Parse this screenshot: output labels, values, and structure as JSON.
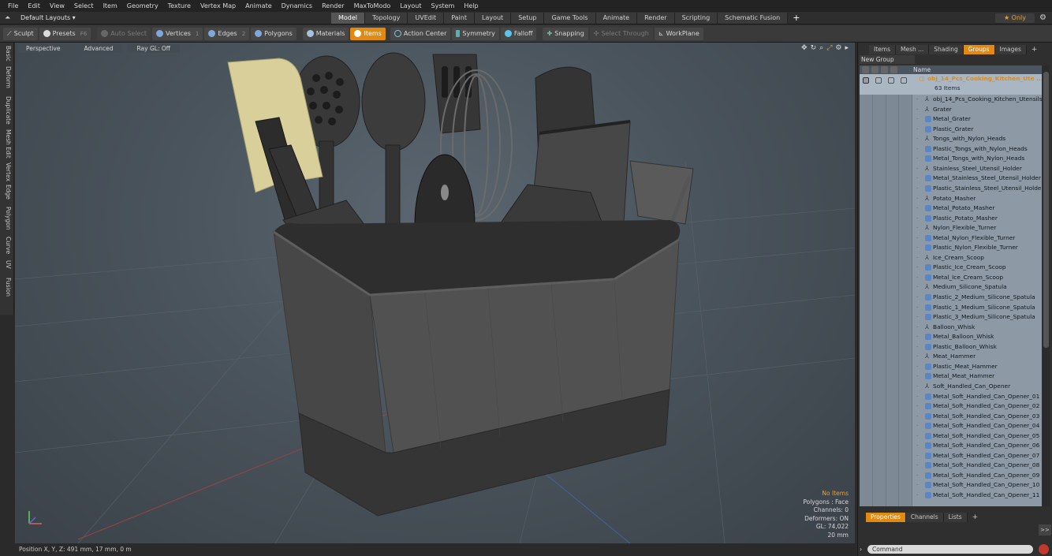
{
  "menu": [
    "File",
    "Edit",
    "View",
    "Select",
    "Item",
    "Geometry",
    "Texture",
    "Vertex Map",
    "Animate",
    "Dynamics",
    "Render",
    "MaxToModo",
    "Layout",
    "System",
    "Help"
  ],
  "layout": {
    "selector": "Default Layouts ▾",
    "tabs": [
      "Model",
      "Topology",
      "UVEdit",
      "Paint",
      "Layout",
      "Setup",
      "Game Tools",
      "Animate",
      "Render",
      "Scripting",
      "Schematic Fusion"
    ],
    "active_tab": "Model",
    "only_label": "★  Only"
  },
  "toolbar": {
    "sculpt": "Sculpt",
    "presets": "Presets",
    "presets_key": "F6",
    "auto_select": "Auto Select",
    "vertices": "Vertices",
    "vertices_num": "1",
    "edges": "Edges",
    "edges_num": "2",
    "polygons": "Polygons",
    "materials": "Materials",
    "items": "Items",
    "action_center": "Action Center",
    "symmetry": "Symmetry",
    "falloff": "Falloff",
    "snapping": "Snapping",
    "select_through": "Select Through",
    "workplane": "WorkPlane"
  },
  "left_tabs": [
    "Basic",
    "Deform",
    "Duplicate",
    "Mesh Edit",
    "Vertex",
    "Edge",
    "Polygon",
    "Curve",
    "UV",
    "Fusion"
  ],
  "viewport": {
    "view": "Perspective",
    "shading": "Advanced",
    "raygl": "Ray GL: Off",
    "stats": {
      "no_items": "No Items",
      "polygons": "Polygons : Face",
      "channels": "Channels: 0",
      "deformers": "Deformers: ON",
      "gl": "GL: 74,022",
      "size": "20 mm"
    }
  },
  "status": {
    "position": "Position X, Y, Z:  491 mm, 17 mm, 0 m"
  },
  "right_panel": {
    "tabs": [
      "Items",
      "Mesh ...",
      "Shading",
      "Groups",
      "Images"
    ],
    "active_tab": "Groups",
    "new_group": "New Group",
    "header_name": "Name",
    "group_name": "obj_14_Pcs_Cooking_Kitchen_Ute ...",
    "group_count": "63 Items",
    "items": [
      {
        "name": "obj_14_Pcs_Cooking_Kitchen_Utensils...",
        "kind": "locator"
      },
      {
        "name": "Grater",
        "kind": "locator"
      },
      {
        "name": "Metal_Grater",
        "kind": "mesh"
      },
      {
        "name": "Plastic_Grater",
        "kind": "mesh"
      },
      {
        "name": "Tongs_with_Nylon_Heads",
        "kind": "locator"
      },
      {
        "name": "Plastic_Tongs_with_Nylon_Heads",
        "kind": "mesh"
      },
      {
        "name": "Metal_Tongs_with_Nylon_Heads",
        "kind": "mesh"
      },
      {
        "name": "Stainless_Steel_Utensil_Holder",
        "kind": "locator"
      },
      {
        "name": "Metal_Stainless_Steel_Utensil_Holder",
        "kind": "mesh"
      },
      {
        "name": "Plastic_Stainless_Steel_Utensil_Holder",
        "kind": "mesh"
      },
      {
        "name": "Potato_Masher",
        "kind": "locator"
      },
      {
        "name": "Metal_Potato_Masher",
        "kind": "mesh"
      },
      {
        "name": "Plastic_Potato_Masher",
        "kind": "mesh"
      },
      {
        "name": "Nylon_Flexible_Turner",
        "kind": "locator"
      },
      {
        "name": "Metal_Nylon_Flexible_Turner",
        "kind": "mesh"
      },
      {
        "name": "Plastic_Nylon_Flexible_Turner",
        "kind": "mesh"
      },
      {
        "name": "Ice_Cream_Scoop",
        "kind": "locator"
      },
      {
        "name": "Plastic_Ice_Cream_Scoop",
        "kind": "mesh"
      },
      {
        "name": "Metal_Ice_Cream_Scoop",
        "kind": "mesh"
      },
      {
        "name": "Medium_Silicone_Spatula",
        "kind": "locator"
      },
      {
        "name": "Plastic_2_Medium_Silicone_Spatula",
        "kind": "mesh"
      },
      {
        "name": "Plastic_1_Medium_Silicone_Spatula",
        "kind": "mesh"
      },
      {
        "name": "Plastic_3_Medium_Silicone_Spatula",
        "kind": "mesh"
      },
      {
        "name": "Balloon_Whisk",
        "kind": "locator"
      },
      {
        "name": "Metal_Balloon_Whisk",
        "kind": "mesh"
      },
      {
        "name": "Plastic_Balloon_Whisk",
        "kind": "mesh"
      },
      {
        "name": "Meat_Hammer",
        "kind": "locator"
      },
      {
        "name": "Plastic_Meat_Hammer",
        "kind": "mesh"
      },
      {
        "name": "Metal_Meat_Hammer",
        "kind": "mesh"
      },
      {
        "name": "Soft_Handled_Can_Opener",
        "kind": "locator"
      },
      {
        "name": "Metal_Soft_Handled_Can_Opener_01",
        "kind": "mesh"
      },
      {
        "name": "Metal_Soft_Handled_Can_Opener_02",
        "kind": "mesh"
      },
      {
        "name": "Metal_Soft_Handled_Can_Opener_03",
        "kind": "mesh"
      },
      {
        "name": "Metal_Soft_Handled_Can_Opener_04",
        "kind": "mesh"
      },
      {
        "name": "Metal_Soft_Handled_Can_Opener_05",
        "kind": "mesh"
      },
      {
        "name": "Metal_Soft_Handled_Can_Opener_06",
        "kind": "mesh"
      },
      {
        "name": "Metal_Soft_Handled_Can_Opener_07",
        "kind": "mesh"
      },
      {
        "name": "Metal_Soft_Handled_Can_Opener_08",
        "kind": "mesh"
      },
      {
        "name": "Metal_Soft_Handled_Can_Opener_09",
        "kind": "mesh"
      },
      {
        "name": "Metal_Soft_Handled_Can_Opener_10",
        "kind": "mesh"
      },
      {
        "name": "Metal_Soft_Handled_Can_Opener_11",
        "kind": "mesh"
      }
    ],
    "bottom_tabs": [
      "Properties",
      "Channels",
      "Lists"
    ],
    "active_bottom_tab": "Properties",
    "expand_label": ">>",
    "command_placeholder": "Command"
  },
  "colors": {
    "accent": "#e08a12",
    "list_bg": "#8d9aa6",
    "viewport_bg": "#4a545c"
  }
}
